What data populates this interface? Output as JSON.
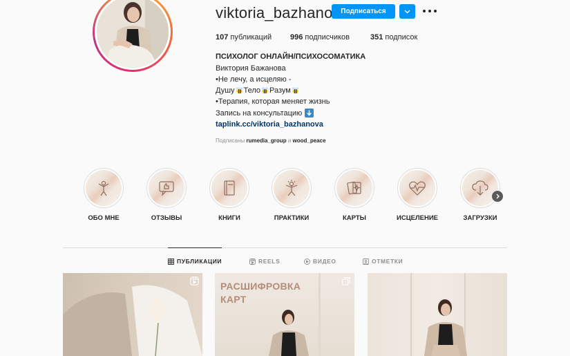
{
  "profile": {
    "username": "viktoria_bazhanova",
    "follow_label": "Подписаться",
    "stats": {
      "posts_count": "107",
      "posts_label": "публикаций",
      "followers_count": "996",
      "followers_label": "подписчиков",
      "following_count": "351",
      "following_label": "подписок"
    },
    "bio": {
      "title": "ПСИХОЛОГ ОНЛАЙН/ПСИХОСОМАТИКА",
      "name": "Виктория Бажанова",
      "line1": "•Не лечу, а исцеляю -",
      "line2_a": "Душу",
      "line2_b": "Тело",
      "line2_c": "Разум",
      "line3": "•Терапия, которая меняет жизнь",
      "line4": "Запись на консультацию",
      "link": "taplink.cc/viktoria_bazhanova"
    },
    "followed_by": {
      "prefix": "Подписаны",
      "user1": "rumedia_group",
      "conj": "и",
      "user2": "wood_peace"
    }
  },
  "highlights": [
    {
      "label": "ОБО МНЕ",
      "icon": "person-arms-up-icon"
    },
    {
      "label": "ОТЗЫВЫ",
      "icon": "chat-thumbs-up-icon"
    },
    {
      "label": "КНИГИ",
      "icon": "book-icon"
    },
    {
      "label": "ПРАКТИКИ",
      "icon": "person-sun-icon"
    },
    {
      "label": "КАРТЫ",
      "icon": "cards-icon"
    },
    {
      "label": "ИСЦЕЛЕНИЕ",
      "icon": "heart-pulse-icon"
    },
    {
      "label": "ЗАГРУЗКИ",
      "icon": "cloud-download-icon"
    }
  ],
  "tabs": {
    "posts": "ПУБЛИКАЦИИ",
    "reels": "REELS",
    "video": "ВИДЕО",
    "tagged": "ОТМЕТКИ"
  },
  "posts": [
    {
      "title": ""
    },
    {
      "title_line1": "РАСШИФРОВКА",
      "title_line2": "КАРТ"
    },
    {
      "title": ""
    }
  ],
  "colors": {
    "accent": "#0095f6",
    "link": "#00376b",
    "muted": "#8e8e8e",
    "text": "#262626",
    "post_title": "#b38d78"
  }
}
